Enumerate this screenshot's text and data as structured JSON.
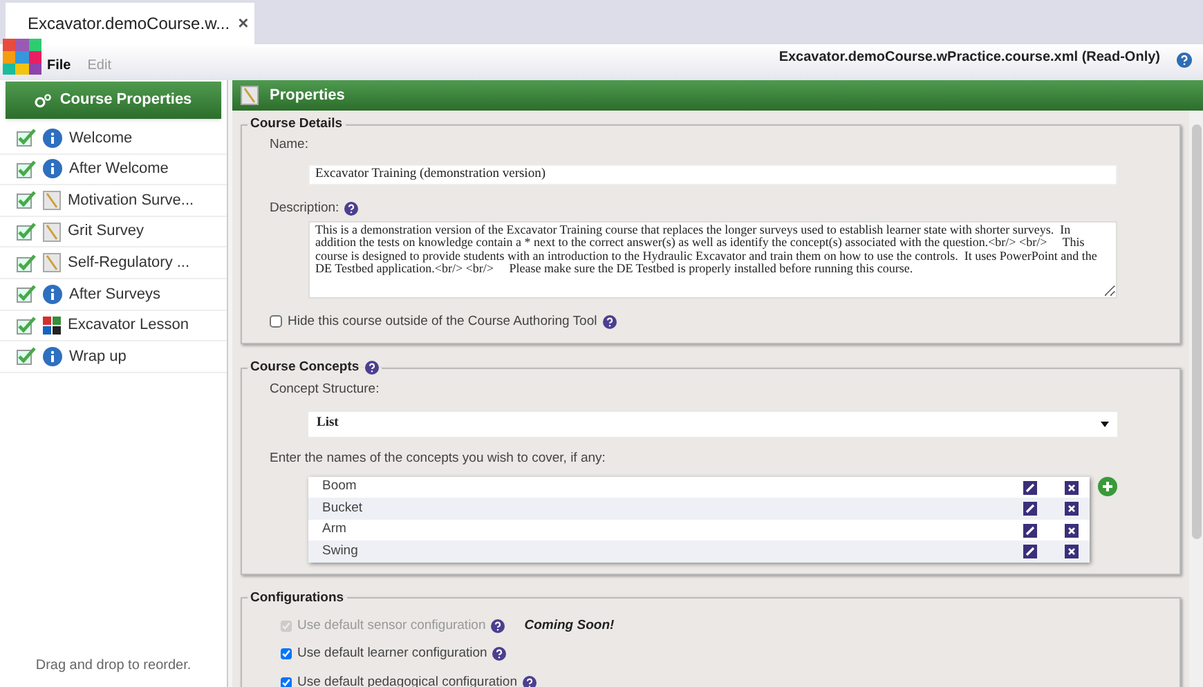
{
  "tab": {
    "title": "Excavator.demoCourse.w...",
    "close": "×"
  },
  "menu": [
    {
      "label": "File",
      "disabled": false
    },
    {
      "label": "Edit",
      "disabled": true
    }
  ],
  "file_title": "Excavator.demoCourse.wPractice.course.xml (Read-Only)",
  "sidebar": {
    "header": "Course Properties",
    "items": [
      {
        "label": "Welcome",
        "kind": "info",
        "checked": true
      },
      {
        "label": "After Welcome",
        "kind": "info",
        "checked": true
      },
      {
        "label": "Motivation Surve...",
        "kind": "survey",
        "checked": true
      },
      {
        "label": "Grit Survey",
        "kind": "survey",
        "checked": true
      },
      {
        "label": "Self-Regulatory ...",
        "kind": "survey",
        "checked": true
      },
      {
        "label": "After Surveys",
        "kind": "info",
        "checked": true
      },
      {
        "label": "Excavator Lesson",
        "kind": "lesson",
        "checked": true
      },
      {
        "label": "Wrap up",
        "kind": "info",
        "checked": true
      }
    ],
    "footer": "Drag and drop to reorder."
  },
  "panel": {
    "title": "Properties",
    "course_details": {
      "legend": "Course Details",
      "name_label": "Name:",
      "name_value": "Excavator Training (demonstration version)",
      "description_label": "Description:",
      "description_value": "This is a demonstration version of the Excavator Training course that replaces the longer surveys used to establish learner state with shorter surveys.  In addition the tests on knowledge contain a * next to the correct answer(s) as well as identify the concept(s) associated with the question.<br/> <br/>     This course is designed to provide students with an introduction to the Hydraulic Excavator and train them on how to use the controls.  It uses PowerPoint and the DE Testbed application.<br/> <br/>     Please make sure the DE Testbed is properly installed before running this course.",
      "hide_label": "Hide this course outside of the Course Authoring Tool",
      "hide_checked": false
    },
    "course_concepts": {
      "legend": "Course Concepts",
      "structure_label": "Concept Structure:",
      "structure_value": "List",
      "concepts_label": "Enter the names of the concepts you wish to cover, if any:",
      "concepts": [
        "Boom",
        "Bucket",
        "Arm",
        "Swing"
      ]
    },
    "configurations": {
      "legend": "Configurations",
      "items": [
        {
          "label": "Use default sensor configuration",
          "checked": true,
          "disabled": true,
          "note": "Coming Soon!"
        },
        {
          "label": "Use default learner configuration",
          "checked": true,
          "disabled": false
        },
        {
          "label": "Use default pedagogical configuration",
          "checked": true,
          "disabled": false
        }
      ]
    }
  }
}
